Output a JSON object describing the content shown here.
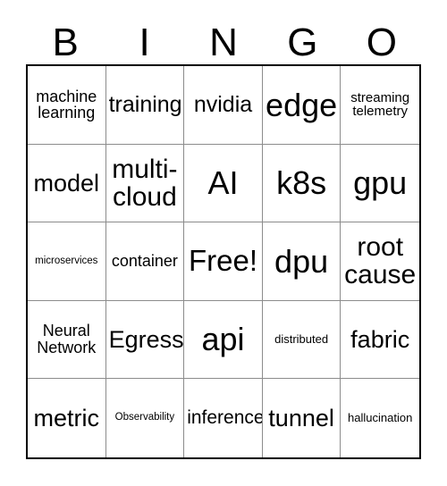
{
  "card": {
    "title": "BINGO",
    "header_letters": [
      "B",
      "I",
      "N",
      "G",
      "O"
    ],
    "grid_size": "5x5",
    "free_space": "Free!",
    "colors": {
      "background": "#ffffff",
      "text": "#000000",
      "outer_border": "#000000",
      "inner_grid_line": "#8c8c8c"
    },
    "cells": [
      {
        "text": "machine\nlearning",
        "size": "fs-s",
        "lines": 2
      },
      {
        "text": "training",
        "size": "fs-m",
        "lines": 1
      },
      {
        "text": "nvidia",
        "size": "fs-m",
        "lines": 1
      },
      {
        "text": "edge",
        "size": "fs-xxl",
        "lines": 1
      },
      {
        "text": "streaming\ntelemetry",
        "size": "fs-xs",
        "lines": 2
      },
      {
        "text": "model",
        "size": "fs-ml",
        "lines": 1
      },
      {
        "text": "multi-\ncloud",
        "size": "fs-l",
        "lines": 2
      },
      {
        "text": "AI",
        "size": "fs-xxl",
        "lines": 1
      },
      {
        "text": "k8s",
        "size": "fs-xxl",
        "lines": 1
      },
      {
        "text": "gpu",
        "size": "fs-xxl",
        "lines": 1
      },
      {
        "text": "microservices",
        "size": "fs-tiny",
        "lines": 1
      },
      {
        "text": "container",
        "size": "fs-s",
        "lines": 1
      },
      {
        "text": "Free!",
        "size": "fs-xl",
        "lines": 1
      },
      {
        "text": "dpu",
        "size": "fs-xxl",
        "lines": 1
      },
      {
        "text": "root\ncause",
        "size": "fs-l",
        "lines": 2
      },
      {
        "text": "Neural\nNetwork",
        "size": "fs-s",
        "lines": 2
      },
      {
        "text": "Egress",
        "size": "fs-ml",
        "lines": 1
      },
      {
        "text": "api",
        "size": "fs-xxl",
        "lines": 1
      },
      {
        "text": "distributed",
        "size": "fs-xxs",
        "lines": 1
      },
      {
        "text": "fabric",
        "size": "fs-ml",
        "lines": 1
      }
    ],
    "cells_row5": [
      {
        "text": "metric",
        "size": "fs-ml",
        "lines": 1
      },
      {
        "text": "Observability",
        "size": "fs-tiny",
        "lines": 1
      },
      {
        "text": "inference",
        "size": "fs-sm",
        "lines": 1
      },
      {
        "text": "tunnel",
        "size": "fs-ml",
        "lines": 1
      },
      {
        "text": "hallucination",
        "size": "fs-xxs",
        "lines": 1
      }
    ]
  }
}
